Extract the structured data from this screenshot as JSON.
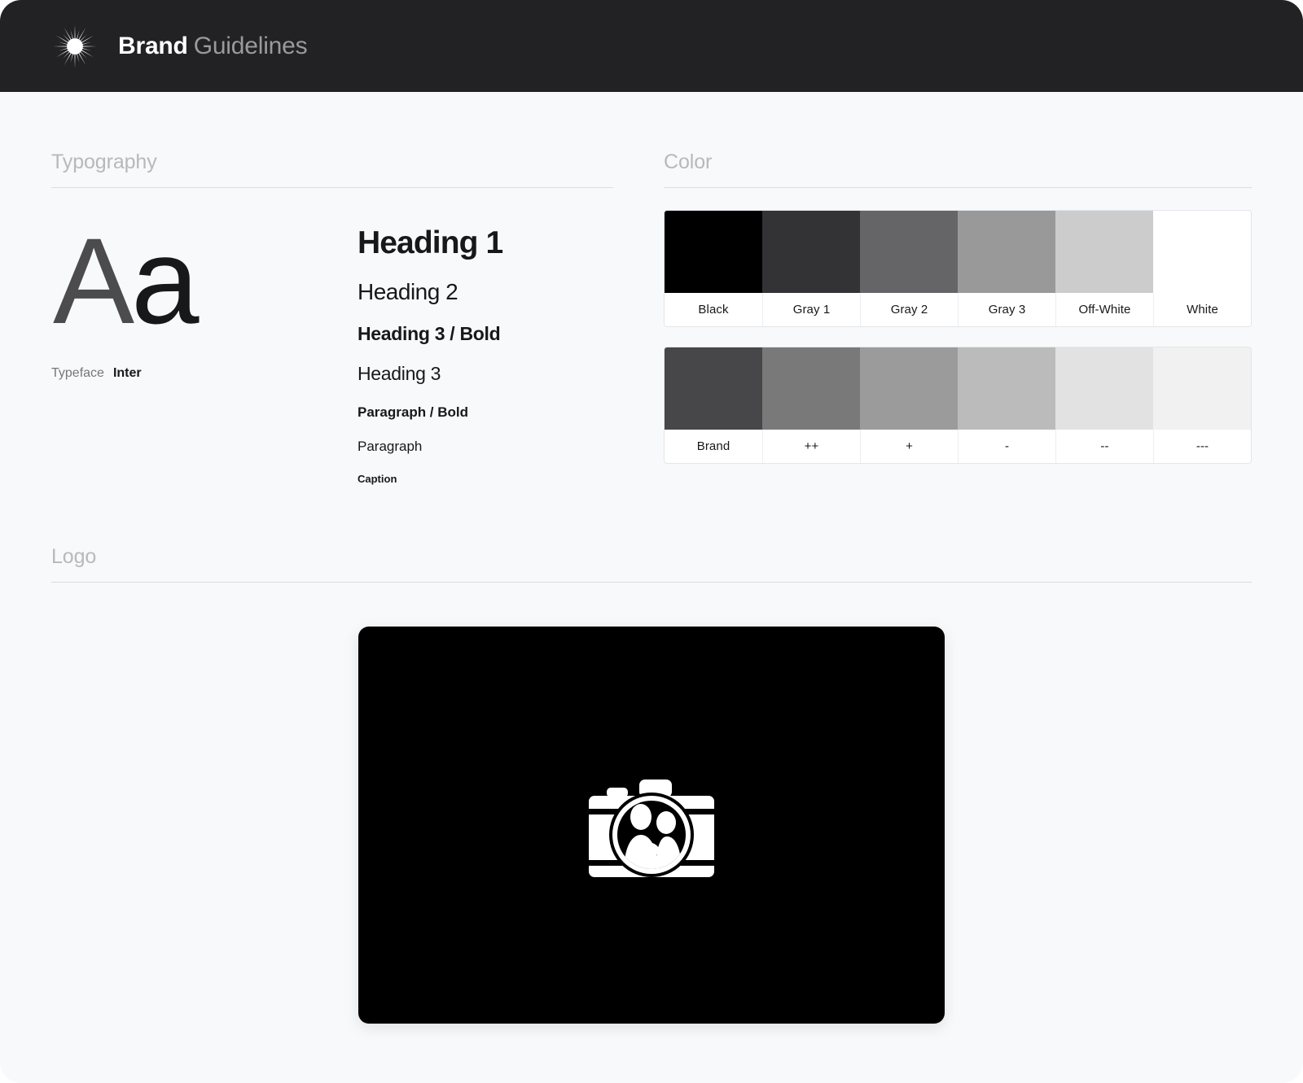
{
  "header": {
    "icon": "starburst-icon",
    "title_strong": "Brand",
    "title_light": "Guidelines"
  },
  "typography": {
    "section_title": "Typography",
    "specimen_upper": "A",
    "specimen_lower": "a",
    "typeface_label": "Typeface",
    "typeface_value": "Inter",
    "scale": [
      {
        "label": "Heading 1",
        "style": "h1"
      },
      {
        "label": "Heading 2",
        "style": "h2"
      },
      {
        "label": "Heading 3 / Bold",
        "style": "h3-bold"
      },
      {
        "label": "Heading 3",
        "style": "h3"
      },
      {
        "label": "Paragraph / Bold",
        "style": "paragraph-bold"
      },
      {
        "label": "Paragraph",
        "style": "paragraph"
      },
      {
        "label": "Caption",
        "style": "caption"
      }
    ]
  },
  "color": {
    "section_title": "Color",
    "rows": [
      {
        "name": "neutrals",
        "swatches": [
          {
            "label": "Black",
            "hex": "#000000"
          },
          {
            "label": "Gray 1",
            "hex": "#333335"
          },
          {
            "label": "Gray 2",
            "hex": "#656567"
          },
          {
            "label": "Gray 3",
            "hex": "#999999"
          },
          {
            "label": "Off-White",
            "hex": "#cccccc"
          },
          {
            "label": "White",
            "hex": "#ffffff"
          }
        ]
      },
      {
        "name": "brand-scale",
        "swatches": [
          {
            "label": "Brand",
            "hex": "#474648"
          },
          {
            "label": "++",
            "hex": "#797979"
          },
          {
            "label": "+",
            "hex": "#9b9b9b"
          },
          {
            "label": "-",
            "hex": "#bbbbbb"
          },
          {
            "label": "--",
            "hex": "#e2e2e2"
          },
          {
            "label": "---",
            "hex": "#f0f1f0"
          }
        ]
      }
    ]
  },
  "logo": {
    "section_title": "Logo",
    "card_background": "#000000",
    "mark_color": "#ffffff",
    "mark_name": "camera-with-couple-logo"
  }
}
